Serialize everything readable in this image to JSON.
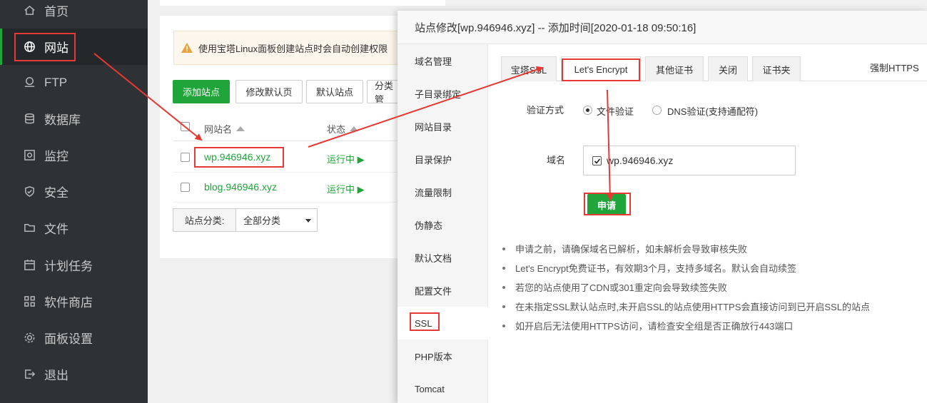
{
  "sidebar": {
    "items": [
      {
        "label": "首页",
        "icon": "home-icon"
      },
      {
        "label": "网站",
        "icon": "globe-icon",
        "active": true
      },
      {
        "label": "FTP",
        "icon": "ftp-icon"
      },
      {
        "label": "数据库",
        "icon": "database-icon"
      },
      {
        "label": "监控",
        "icon": "monitor-icon"
      },
      {
        "label": "安全",
        "icon": "shield-icon"
      },
      {
        "label": "文件",
        "icon": "folder-icon"
      },
      {
        "label": "计划任务",
        "icon": "calendar-icon"
      },
      {
        "label": "软件商店",
        "icon": "grid-icon"
      },
      {
        "label": "面板设置",
        "icon": "gear-icon"
      },
      {
        "label": "退出",
        "icon": "logout-icon"
      }
    ]
  },
  "site_list": {
    "warning_text": "使用宝塔Linux面板创建站点时会自动创建权限",
    "buttons": {
      "add_site": "添加站点",
      "edit_default_page": "修改默认页",
      "default_site": "默认站点",
      "category": "分类管"
    },
    "columns": {
      "name": "网站名",
      "status": "状态"
    },
    "rows": [
      {
        "name": "wp.946946.xyz",
        "status": "运行中 ▶"
      },
      {
        "name": "blog.946946.xyz",
        "status": "运行中 ▶"
      }
    ],
    "filter": {
      "label": "站点分类:",
      "value": "全部分类"
    }
  },
  "modal": {
    "title": "站点修改[wp.946946.xyz] -- 添加时间[2020-01-18 09:50:16]",
    "side_items": [
      "域名管理",
      "子目录绑定",
      "网站目录",
      "目录保护",
      "流量限制",
      "伪静态",
      "默认文档",
      "配置文件",
      "SSL",
      "PHP版本",
      "Tomcat"
    ],
    "active_side": "SSL",
    "tabs": [
      "宝塔SSL",
      "Let's Encrypt",
      "其他证书",
      "关闭",
      "证书夹"
    ],
    "active_tab": "Let's Encrypt",
    "force_https": "强制HTTPS",
    "verify_label": "验证方式",
    "verify_options": [
      "文件验证",
      "DNS验证(支持通配符)"
    ],
    "domain_label": "域名",
    "domain_value": "wp.946946.xyz",
    "apply_button": "申请",
    "notes": [
      "申请之前，请确保域名已解析，如未解析会导致审核失败",
      "Let's Encrypt免费证书，有效期3个月，支持多域名。默认会自动续签",
      "若您的站点使用了CDN或301重定向会导致续签失败",
      "在未指定SSL默认站点时,未开启SSL的站点使用HTTPS会直接访问到已开启SSL的站点",
      "如开启后无法使用HTTPS访问，请检查安全组是否正确放行443端口"
    ]
  },
  "colors": {
    "accent": "#20a53a",
    "annotation": "#e53935",
    "sidebar_bg": "#2f3235"
  }
}
